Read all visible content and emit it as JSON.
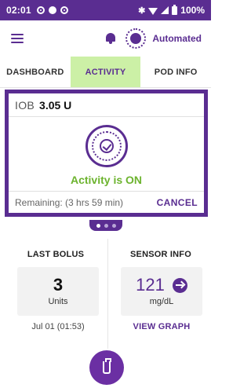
{
  "status_bar": {
    "time": "02:01",
    "battery": "100%"
  },
  "app_bar": {
    "mode": "Automated"
  },
  "tabs": [
    {
      "label": "DASHBOARD"
    },
    {
      "label": "ACTIVITY"
    },
    {
      "label": "POD INFO"
    }
  ],
  "activity": {
    "iob_label": "IOB",
    "iob_value": "3.05 U",
    "status": "Activity is ON",
    "remaining": "Remaining: (3 hrs 59 min)",
    "cancel_label": "CANCEL"
  },
  "last_bolus": {
    "title": "LAST BOLUS",
    "value": "3",
    "unit": "Units",
    "date": "Jul 01 (01:53)"
  },
  "sensor_info": {
    "title": "SENSOR INFO",
    "value": "121",
    "unit": "mg/dL",
    "link": "VIEW GRAPH"
  },
  "colors": {
    "brand": "#5a2d91",
    "active_tab_bg": "#ccf0a6",
    "status_green": "#6cb32e"
  }
}
